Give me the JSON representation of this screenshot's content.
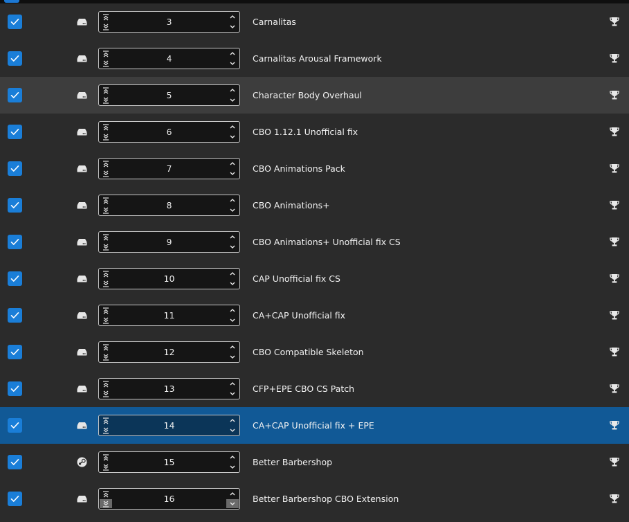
{
  "colors": {
    "accent": "#1a7ed8",
    "row_bg": "#2b2b2b",
    "row_hover": "#3d3d3d",
    "row_selected": "#115996"
  },
  "icons": {
    "checkbox": "checkmark-icon",
    "source_default": "hard-drive-icon",
    "source_steam": "steam-icon",
    "send_to_top": "double-chevron-up-bar-icon",
    "send_to_bottom": "double-chevron-down-bar-icon",
    "increment": "chevron-up-icon",
    "decrement": "chevron-down-icon",
    "endorse": "trophy-icon"
  },
  "mods": [
    {
      "enabled": true,
      "priority": "3",
      "name": "Carnalitas",
      "source": "drive",
      "state": "normal"
    },
    {
      "enabled": true,
      "priority": "4",
      "name": "Carnalitas Arousal Framework",
      "source": "drive",
      "state": "normal"
    },
    {
      "enabled": true,
      "priority": "5",
      "name": "Character Body Overhaul",
      "source": "drive",
      "state": "hover"
    },
    {
      "enabled": true,
      "priority": "6",
      "name": "CBO 1.12.1 Unofficial fix",
      "source": "drive",
      "state": "normal"
    },
    {
      "enabled": true,
      "priority": "7",
      "name": "CBO Animations Pack",
      "source": "drive",
      "state": "normal"
    },
    {
      "enabled": true,
      "priority": "8",
      "name": "CBO Animations+",
      "source": "drive",
      "state": "normal"
    },
    {
      "enabled": true,
      "priority": "9",
      "name": "CBO Animations+ Unofficial fix CS",
      "source": "drive",
      "state": "normal"
    },
    {
      "enabled": true,
      "priority": "10",
      "name": "CAP Unofficial fix CS",
      "source": "drive",
      "state": "normal"
    },
    {
      "enabled": true,
      "priority": "11",
      "name": "CA+CAP Unofficial fix",
      "source": "drive",
      "state": "normal"
    },
    {
      "enabled": true,
      "priority": "12",
      "name": "CBO Compatible Skeleton",
      "source": "drive",
      "state": "normal"
    },
    {
      "enabled": true,
      "priority": "13",
      "name": "CFP+EPE CBO CS Patch",
      "source": "drive",
      "state": "normal"
    },
    {
      "enabled": true,
      "priority": "14",
      "name": "CA+CAP Unofficial fix + EPE",
      "source": "drive",
      "state": "selected"
    },
    {
      "enabled": true,
      "priority": "15",
      "name": "Better Barbershop",
      "source": "steam",
      "state": "normal"
    },
    {
      "enabled": true,
      "priority": "16",
      "name": "Better Barbershop CBO Extension",
      "source": "drive",
      "state": "normal",
      "last": true
    }
  ]
}
